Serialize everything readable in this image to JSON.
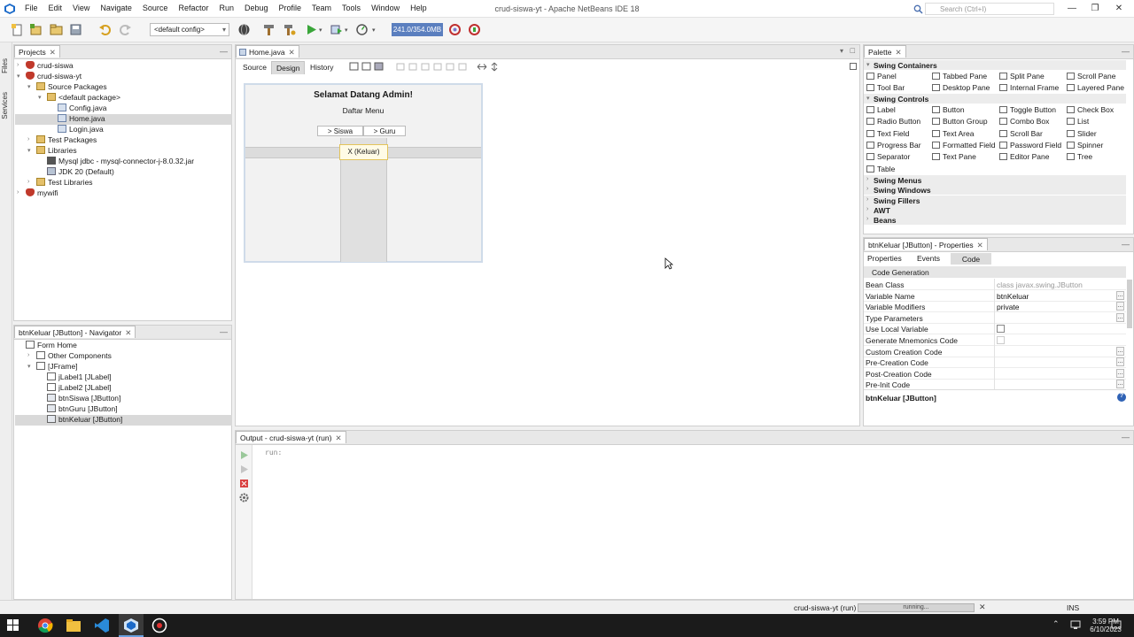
{
  "window": {
    "title": "crud-siswa-yt - Apache NetBeans IDE 18",
    "search_placeholder": "Search (Ctrl+I)"
  },
  "menu": [
    "File",
    "Edit",
    "View",
    "Navigate",
    "Source",
    "Refactor",
    "Run",
    "Debug",
    "Profile",
    "Team",
    "Tools",
    "Window",
    "Help"
  ],
  "toolbar": {
    "config": "<default config>",
    "memory": "241.0/354.0MB"
  },
  "leftstrip": {
    "files": "Files",
    "services": "Services"
  },
  "projects": {
    "tab": "Projects",
    "rows": [
      {
        "label": "crud-siswa",
        "indent": 0
      },
      {
        "label": "crud-siswa-yt",
        "indent": 0
      },
      {
        "label": "Source Packages",
        "indent": 1
      },
      {
        "label": "<default package>",
        "indent": 2
      },
      {
        "label": "Config.java",
        "indent": 3
      },
      {
        "label": "Home.java",
        "indent": 3
      },
      {
        "label": "Login.java",
        "indent": 3
      },
      {
        "label": "Test Packages",
        "indent": 1
      },
      {
        "label": "Libraries",
        "indent": 1
      },
      {
        "label": "Mysql jdbc - mysql-connector-j-8.0.32.jar",
        "indent": 2
      },
      {
        "label": "JDK 20 (Default)",
        "indent": 2
      },
      {
        "label": "Test Libraries",
        "indent": 1
      },
      {
        "label": "mywifi",
        "indent": 0
      }
    ]
  },
  "navigator": {
    "tab": "btnKeluar [JButton] - Navigator",
    "rows": [
      {
        "label": "Form Home",
        "indent": 0
      },
      {
        "label": "Other Components",
        "indent": 1
      },
      {
        "label": "[JFrame]",
        "indent": 1
      },
      {
        "label": "jLabel1 [JLabel]",
        "indent": 2
      },
      {
        "label": "jLabel2 [JLabel]",
        "indent": 2
      },
      {
        "label": "btnSiswa [JButton]",
        "indent": 2
      },
      {
        "label": "btnGuru [JButton]",
        "indent": 2
      },
      {
        "label": "btnKeluar [JButton]",
        "indent": 2
      }
    ]
  },
  "editor": {
    "tab": "Home.java",
    "subtabs": [
      "Source",
      "Design",
      "History"
    ],
    "form": {
      "title": "Selamat Datang Admin!",
      "subtitle": "Daftar Menu",
      "btn_siswa": "> Siswa",
      "btn_guru": "> Guru",
      "btn_keluar": "X (Keluar)"
    }
  },
  "palette": {
    "tab": "Palette",
    "categories": [
      "Swing Containers",
      "Swing Controls",
      "Swing Menus",
      "Swing Windows",
      "Swing Fillers",
      "AWT",
      "Beans"
    ],
    "containers": [
      "Panel",
      "Tabbed Pane",
      "Split Pane",
      "Scroll Pane",
      "Tool Bar",
      "Desktop Pane",
      "Internal Frame",
      "Layered Pane"
    ],
    "controls": [
      "Label",
      "Button",
      "Toggle Button",
      "Check Box",
      "Radio Button",
      "Button Group",
      "Combo Box",
      "List",
      "Text Field",
      "Text Area",
      "Scroll Bar",
      "Slider",
      "Progress Bar",
      "Formatted Field",
      "Password Field",
      "Spinner",
      "Separator",
      "Text Pane",
      "Editor Pane",
      "Tree",
      "Table"
    ]
  },
  "properties": {
    "tab": "btnKeluar [JButton] - Properties",
    "subtabs": [
      "Properties",
      "Events",
      "Code"
    ],
    "section": "Code Generation",
    "rows": [
      {
        "k": "Bean Class",
        "v": "class javax.swing.JButton"
      },
      {
        "k": "Variable Name",
        "v": "btnKeluar"
      },
      {
        "k": "Variable Modifiers",
        "v": "private"
      },
      {
        "k": "Type Parameters",
        "v": ""
      },
      {
        "k": "Use Local Variable",
        "v": ""
      },
      {
        "k": "Generate Mnemonics Code",
        "v": ""
      },
      {
        "k": "Custom Creation Code",
        "v": ""
      },
      {
        "k": "Pre-Creation Code",
        "v": ""
      },
      {
        "k": "Post-Creation Code",
        "v": ""
      },
      {
        "k": "Pre-Init Code",
        "v": ""
      }
    ],
    "footer": "btnKeluar [JButton]"
  },
  "output": {
    "tab": "Output - crud-siswa-yt (run)",
    "text": "run:"
  },
  "status": {
    "task": "crud-siswa-yt (run)",
    "progress": "running...",
    "mode": "INS"
  },
  "taskbar": {
    "time": "3:59 PM",
    "date": "6/10/2023"
  },
  "colors": {
    "accent": "#5b7fbf",
    "selection": "#d9d9d9"
  }
}
